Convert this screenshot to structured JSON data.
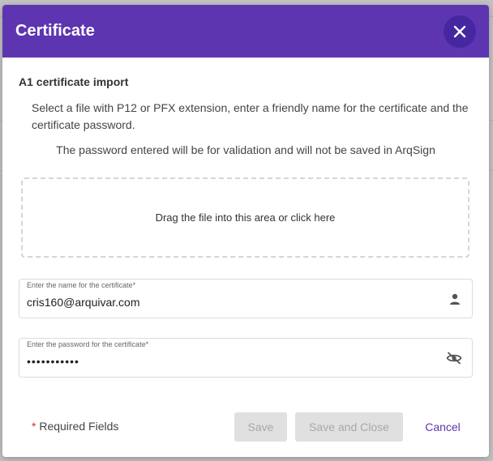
{
  "dialog": {
    "title": "Certificate",
    "close_icon": "close-icon",
    "section_title": "A1 certificate import",
    "instructions": "Select a file with P12 or PFX extension, enter a friendly name for the certificate and the certificate password.",
    "notice": "The password entered will be for validation and will not be saved in ArqSign",
    "dropzone_text": "Drag the file into this area or click here",
    "name_field": {
      "label": "Enter the name for the certificate*",
      "value": "cris160@arquivar.com",
      "icon": "person-icon"
    },
    "password_field": {
      "label": "Enter the password for the certificate*",
      "value": "•••••••••••",
      "icon": "eye-off-icon"
    },
    "footer": {
      "required_star": "*",
      "required_text": " Required Fields",
      "save_label": "Save",
      "save_close_label": "Save and Close",
      "cancel_label": "Cancel"
    }
  },
  "colors": {
    "header": "#5e35b1",
    "close_button": "#4527a0",
    "cancel_text": "#5e35b1",
    "required_star": "#d32f2f"
  }
}
